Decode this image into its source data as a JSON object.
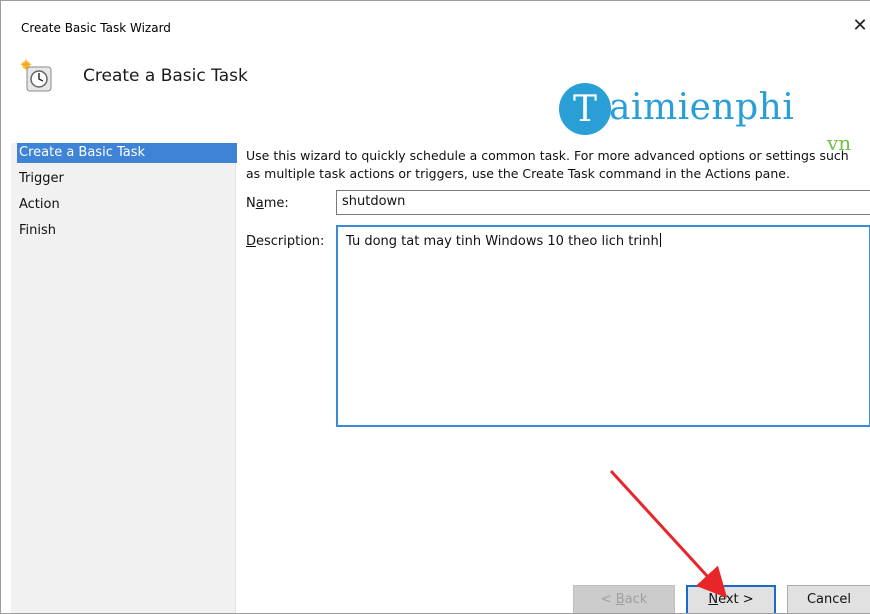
{
  "window": {
    "title": "Create Basic Task Wizard",
    "close_glyph": "✕"
  },
  "header": {
    "title": "Create a Basic Task",
    "icon": "task-scheduler-clock-icon"
  },
  "watermark": {
    "brand_text": "aimienphi",
    "brand_initial": "T",
    "suffix": "vn",
    "colors": {
      "main": "#2a9fd6",
      "suffix": "#6cc24a"
    }
  },
  "sidebar": {
    "items": [
      {
        "label": "Create a Basic Task",
        "active": true
      },
      {
        "label": "Trigger",
        "active": false
      },
      {
        "label": "Action",
        "active": false
      },
      {
        "label": "Finish",
        "active": false
      }
    ]
  },
  "form": {
    "intro": "Use this wizard to quickly schedule a common task.  For more advanced options or settings such as multiple task actions or triggers, use the Create Task command in the Actions pane.",
    "name": {
      "label_prefix": "N",
      "label_underlined": "a",
      "label_suffix": "me:",
      "value": "shutdown"
    },
    "description": {
      "label_underlined": "D",
      "label_rest": "escription:",
      "value": "Tu dong tat may tinh Windows 10 theo lich trinh"
    }
  },
  "buttons": {
    "back": {
      "prefix": "< ",
      "underlined": "B",
      "rest": "ack",
      "enabled": false
    },
    "next": {
      "underlined": "N",
      "rest": "ext >",
      "enabled": true
    },
    "cancel": {
      "label": "Cancel",
      "enabled": true
    }
  },
  "colors": {
    "selection": "#3e83d6",
    "annotation_arrow": "#e8262a",
    "focus_border": "#3d8ad4"
  }
}
